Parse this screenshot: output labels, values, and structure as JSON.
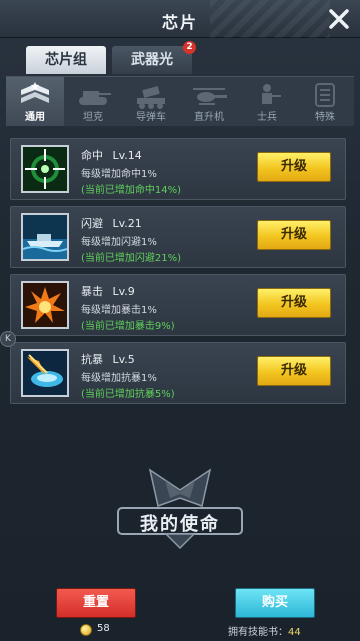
{
  "title": "芯片",
  "tabs": [
    {
      "label": "芯片组",
      "active": true
    },
    {
      "label": "武器光环",
      "active": false,
      "badge": "2"
    }
  ],
  "categories": [
    {
      "label": "通用",
      "icon": "rank-insignia-icon",
      "active": true
    },
    {
      "label": "坦克",
      "icon": "tank-icon",
      "active": false
    },
    {
      "label": "导弹车",
      "icon": "missile-vehicle-icon",
      "active": false
    },
    {
      "label": "直升机",
      "icon": "helicopter-icon",
      "active": false
    },
    {
      "label": "士兵",
      "icon": "soldier-icon",
      "active": false
    },
    {
      "label": "特殊",
      "icon": "special-icon",
      "active": false
    }
  ],
  "skills": [
    {
      "name": "命中",
      "level": "Lv.14",
      "desc": "每级增加命中1%",
      "total": "(当前已增加命中14%)",
      "button": "升级",
      "icon": "crosshair-icon"
    },
    {
      "name": "闪避",
      "level": "Lv.21",
      "desc": "每级增加闪避1%",
      "total": "(当前已增加闪避21%)",
      "button": "升级",
      "icon": "ship-icon"
    },
    {
      "name": "暴击",
      "level": "Lv.9",
      "desc": "每级增加暴击1%",
      "total": "(当前已增加暴击9%)",
      "button": "升级",
      "icon": "explosion-icon"
    },
    {
      "name": "抗暴",
      "level": "Lv.5",
      "desc": "每级增加抗暴1%",
      "total": "(当前已增加抗暴5%)",
      "button": "升级",
      "icon": "shield-burst-icon"
    }
  ],
  "side_handle": "K",
  "logo_text": "我的使命",
  "bottom": {
    "reset_label": "重置",
    "buy_label": "购买",
    "coins": "58",
    "books_label": "拥有技能书：",
    "books_value": "44"
  },
  "colors": {
    "upgrade_button": "#f3c51f",
    "reset_button": "#d42f2a",
    "buy_button": "#2db7d6",
    "total_text": "#5fd05a",
    "badge": "#d6332b"
  }
}
